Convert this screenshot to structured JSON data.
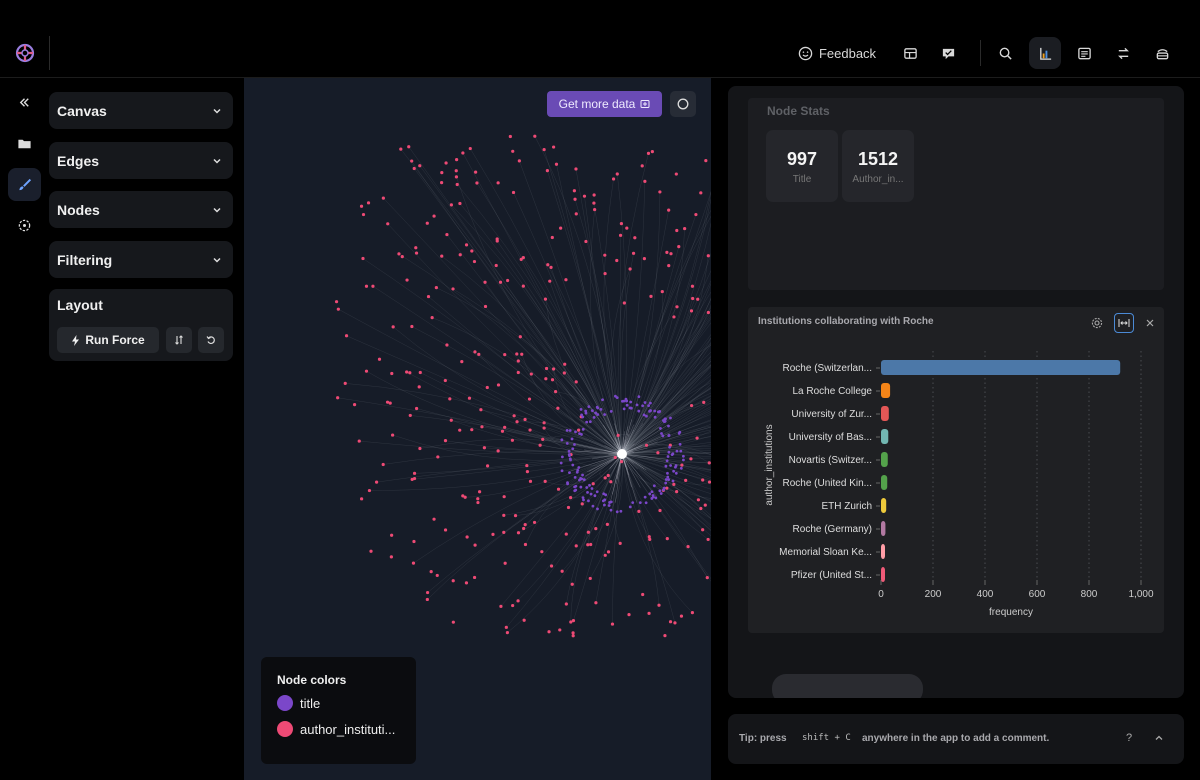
{
  "topbar": {
    "feedback_label": "Feedback",
    "icons": [
      "table-icon",
      "comment-icon",
      "search-icon",
      "chart-icon",
      "list-icon",
      "swap-icon",
      "layers-icon"
    ]
  },
  "rail": {
    "icons": [
      "collapse-icon",
      "folder-icon",
      "brush-icon",
      "target-icon"
    ],
    "active": "brush-icon"
  },
  "sidebar": {
    "panels": [
      {
        "label": "Canvas"
      },
      {
        "label": "Edges"
      },
      {
        "label": "Nodes"
      },
      {
        "label": "Filtering"
      }
    ],
    "layout": {
      "title": "Layout",
      "run_force_label": "Run Force"
    }
  },
  "canvas": {
    "get_more_label": "Get more data",
    "legend": {
      "title": "Node colors",
      "items": [
        {
          "label": "title",
          "color": "#7b47c9"
        },
        {
          "label": "author_instituti...",
          "color": "#ee4a75"
        }
      ]
    },
    "colors": {
      "background": "#161c28",
      "title_node": "#7b47c9",
      "author_node": "#ee4a75"
    }
  },
  "node_stats": {
    "title": "Node Stats",
    "stats": [
      {
        "value": "997",
        "label": "Title"
      },
      {
        "value": "1512",
        "label": "Author_in..."
      }
    ]
  },
  "chart_panel": {
    "title": "Institutions collaborating with Roche"
  },
  "chart_data": {
    "type": "bar",
    "orientation": "horizontal",
    "categories": [
      "Roche (Switzerlan...",
      "La Roche College",
      "University of Zur...",
      "University of Bas...",
      "Novartis (Switzer...",
      "Roche (United Kin...",
      "ETH Zurich",
      "Roche (Germany)",
      "Memorial Sloan Ke...",
      "Pfizer (United St..."
    ],
    "values": [
      920,
      35,
      30,
      28,
      26,
      24,
      20,
      17,
      15,
      14
    ],
    "colors": [
      "#4c78a8",
      "#f58518",
      "#e45756",
      "#72b7b2",
      "#54a24b",
      "#54a24b",
      "#eeca3b",
      "#b279a2",
      "#ff9da6",
      "#f05a78"
    ],
    "xlabel": "frequency",
    "ylabel": "author_institutions",
    "xticks": [
      "0",
      "200",
      "400",
      "600",
      "800",
      "1,000"
    ],
    "xlim": [
      0,
      1000
    ],
    "grid": "vertical dotted"
  },
  "tip": {
    "prefix": "Tip: press",
    "keys": "shift + C",
    "suffix": "anywhere in the app to add a comment.",
    "help": "?"
  }
}
